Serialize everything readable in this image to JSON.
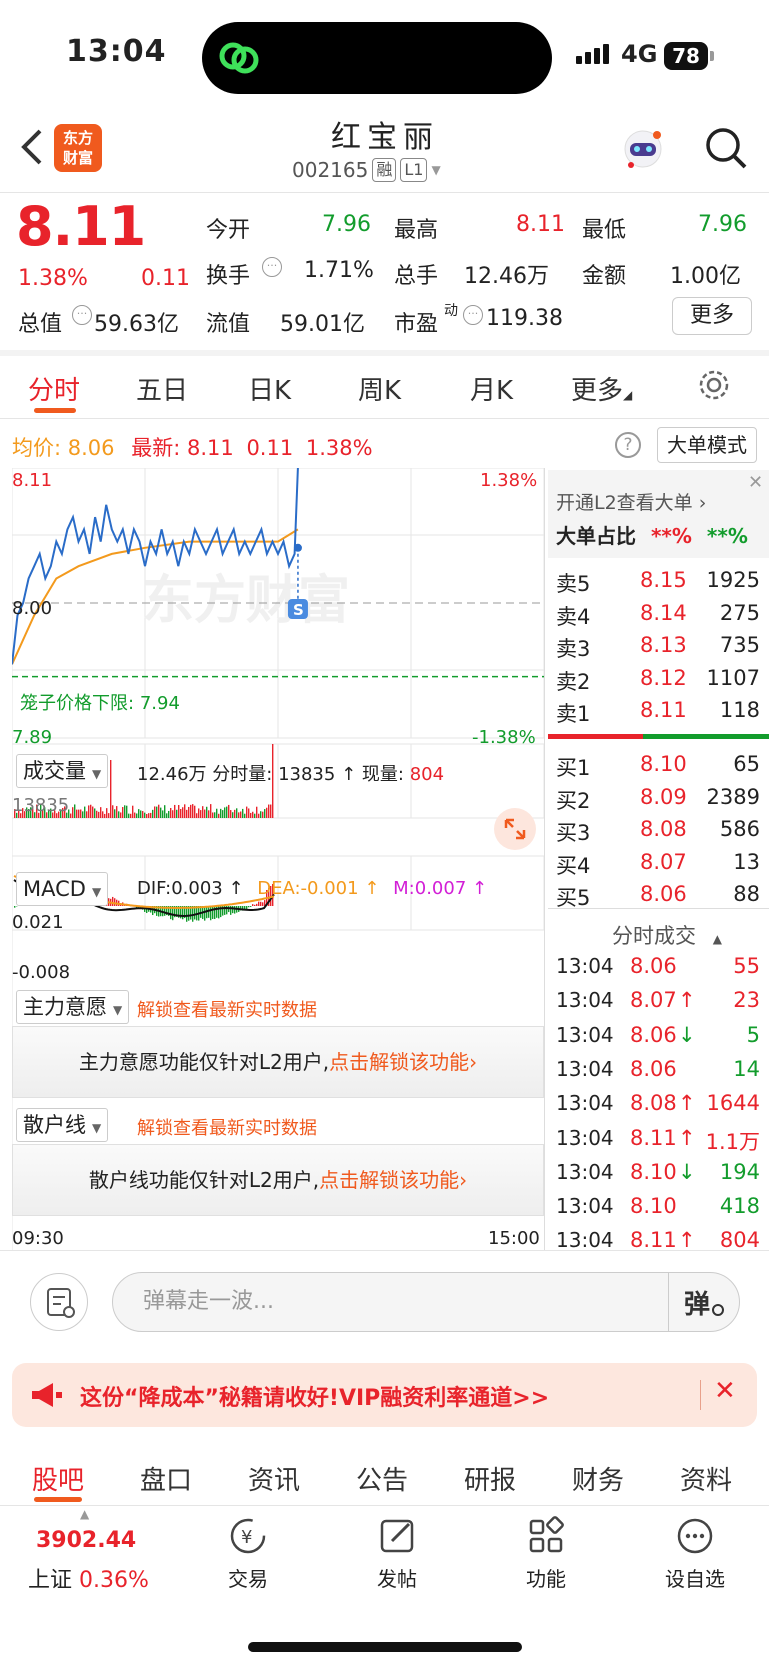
{
  "status_bar": {
    "time": "13:04",
    "network": "4G",
    "battery": "78"
  },
  "header": {
    "logo_line1": "东方",
    "logo_line2": "财富",
    "stock_name": "红宝丽",
    "code": "002165",
    "tag_margin": "融",
    "tag_level": "L1"
  },
  "quote": {
    "price": "8.11",
    "change_pct": "1.38%",
    "change": "0.11",
    "open_label": "今开",
    "open": "7.96",
    "high_label": "最高",
    "high": "8.11",
    "low_label": "最低",
    "low": "7.96",
    "turnover_label": "换手",
    "turnover": "1.71%",
    "volume_label": "总手",
    "volume": "12.46万",
    "amount_label": "金额",
    "amount": "1.00亿",
    "mktcap_label": "总值",
    "mktcap": "59.63亿",
    "float_label": "流值",
    "float": "59.01亿",
    "pe_label": "市盈",
    "pe_sup": "动",
    "pe": "119.38",
    "more": "更多"
  },
  "tabs": [
    "分时",
    "五日",
    "日K",
    "周K",
    "月K",
    "更多"
  ],
  "info_row": {
    "avg_label": "均价:",
    "avg": "8.06",
    "latest_label": "最新:",
    "latest": "8.11",
    "chg": "0.11",
    "pct": "1.38%",
    "qmark": "?",
    "big_mode": "大单模式"
  },
  "chart": {
    "y_top": "8.11",
    "y_mid": "8.00",
    "y_bot": "7.89",
    "pct_top": "1.38%",
    "pct_bot": "-1.38%",
    "cage_label": "笼子价格下限:",
    "cage_value": "7.94",
    "marker": "S",
    "watermark": "东方财富",
    "vol_select": "成交量",
    "vol_total": "12.46万",
    "vol_detail_label": "分时量:",
    "vol_detail": "13835",
    "cur_label": "现量:",
    "cur": "804",
    "vol_max": "13835",
    "macd_select": "MACD",
    "dif": "DIF:0.003",
    "dea": "DEA:-0.001",
    "m": "M:0.007",
    "macd_top": "0.021",
    "macd_bot": "-0.008",
    "time_start": "09:30",
    "time_end": "15:00"
  },
  "chart_data": {
    "type": "line",
    "series": [
      {
        "name": "最新",
        "x": [
          0,
          5,
          10,
          15,
          20,
          25,
          30,
          35,
          40,
          45,
          50,
          55,
          60,
          65,
          70,
          75,
          80,
          85,
          90,
          95,
          100,
          105,
          110,
          115,
          120,
          125,
          130,
          135,
          140,
          145,
          150,
          155,
          160,
          165,
          170,
          175,
          180,
          185,
          190,
          195,
          200,
          205,
          210,
          215,
          220,
          225,
          230,
          235,
          240,
          245,
          250,
          255,
          258
        ],
        "y": [
          7.95,
          7.99,
          8.0,
          8.02,
          8.03,
          8.04,
          8.02,
          8.03,
          8.05,
          8.04,
          8.06,
          8.07,
          8.05,
          8.06,
          8.04,
          8.07,
          8.05,
          8.08,
          8.06,
          8.05,
          8.06,
          8.04,
          8.06,
          8.05,
          8.03,
          8.05,
          8.04,
          8.06,
          8.04,
          8.05,
          8.03,
          8.05,
          8.04,
          8.06,
          8.05,
          8.04,
          8.05,
          8.06,
          8.04,
          8.05,
          8.06,
          8.04,
          8.05,
          8.04,
          8.05,
          8.06,
          8.04,
          8.05,
          8.04,
          8.05,
          8.03,
          8.04,
          8.11
        ]
      },
      {
        "name": "均价",
        "x": [
          0,
          10,
          20,
          40,
          60,
          90,
          120,
          160,
          200,
          240,
          258
        ],
        "y": [
          7.95,
          7.97,
          7.99,
          8.02,
          8.03,
          8.04,
          8.045,
          8.05,
          8.05,
          8.05,
          8.06
        ]
      }
    ],
    "ylim": [
      7.89,
      8.11
    ],
    "reference": 8.0,
    "cage_lower": 7.94
  },
  "locked": {
    "main_select": "主力意愿",
    "main_hint": "解锁查看最新实时数据",
    "main_msg": "主力意愿功能仅针对L2用户,",
    "main_link": "点击解锁该功能",
    "retail_select": "散户线",
    "retail_hint": "解锁查看最新实时数据",
    "retail_msg": "散户线功能仅针对L2用户,",
    "retail_link": "点击解锁该功能"
  },
  "order_book": {
    "l2_banner": "开通L2查看大单",
    "big_ratio_label": "大单占比",
    "big_buy": "**%",
    "big_sell": "**%",
    "asks": [
      {
        "l": "卖5",
        "p": "8.15",
        "v": "1925"
      },
      {
        "l": "卖4",
        "p": "8.14",
        "v": "275"
      },
      {
        "l": "卖3",
        "p": "8.13",
        "v": "735"
      },
      {
        "l": "卖2",
        "p": "8.12",
        "v": "1107"
      },
      {
        "l": "卖1",
        "p": "8.11",
        "v": "118"
      }
    ],
    "bids": [
      {
        "l": "买1",
        "p": "8.10",
        "v": "65"
      },
      {
        "l": "买2",
        "p": "8.09",
        "v": "2389"
      },
      {
        "l": "买3",
        "p": "8.08",
        "v": "586"
      },
      {
        "l": "买4",
        "p": "8.07",
        "v": "13"
      },
      {
        "l": "买5",
        "p": "8.06",
        "v": "88"
      }
    ],
    "ticks_title": "分时成交",
    "ticks": [
      {
        "t": "13:04",
        "p": "8.06",
        "a": "",
        "v": "55",
        "c": "red"
      },
      {
        "t": "13:04",
        "p": "8.07",
        "a": "↑",
        "v": "23",
        "c": "red"
      },
      {
        "t": "13:04",
        "p": "8.06",
        "a": "↓",
        "v": "5",
        "c": "green"
      },
      {
        "t": "13:04",
        "p": "8.06",
        "a": "",
        "v": "14",
        "c": "green"
      },
      {
        "t": "13:04",
        "p": "8.08",
        "a": "↑",
        "v": "1644",
        "c": "red"
      },
      {
        "t": "13:04",
        "p": "8.11",
        "a": "↑",
        "v": "1.1万",
        "c": "red"
      },
      {
        "t": "13:04",
        "p": "8.10",
        "a": "↓",
        "v": "194",
        "c": "green"
      },
      {
        "t": "13:04",
        "p": "8.10",
        "a": "",
        "v": "418",
        "c": "green"
      },
      {
        "t": "13:04",
        "p": "8.11",
        "a": "↑",
        "v": "804",
        "c": "red"
      }
    ]
  },
  "composer": {
    "placeholder": "弹幕走一波...",
    "send": "弹"
  },
  "promo": {
    "text": "这份“降成本”秘籍请收好!VIP融资利率通道>>",
    "close": "✕"
  },
  "bottom_tabs": [
    "股吧",
    "盘口",
    "资讯",
    "公告",
    "研报",
    "财务",
    "资料"
  ],
  "nav": {
    "index_value": "3902.44",
    "index_name": "上证",
    "index_pct": "0.36%",
    "trade": "交易",
    "post": "发帖",
    "func": "功能",
    "watch": "设自选"
  },
  "colors": {
    "up": "#e8232b",
    "down": "#129c2c",
    "accent": "#f05a1e",
    "avg": "#f39a1d",
    "line": "#2a6cc8"
  }
}
